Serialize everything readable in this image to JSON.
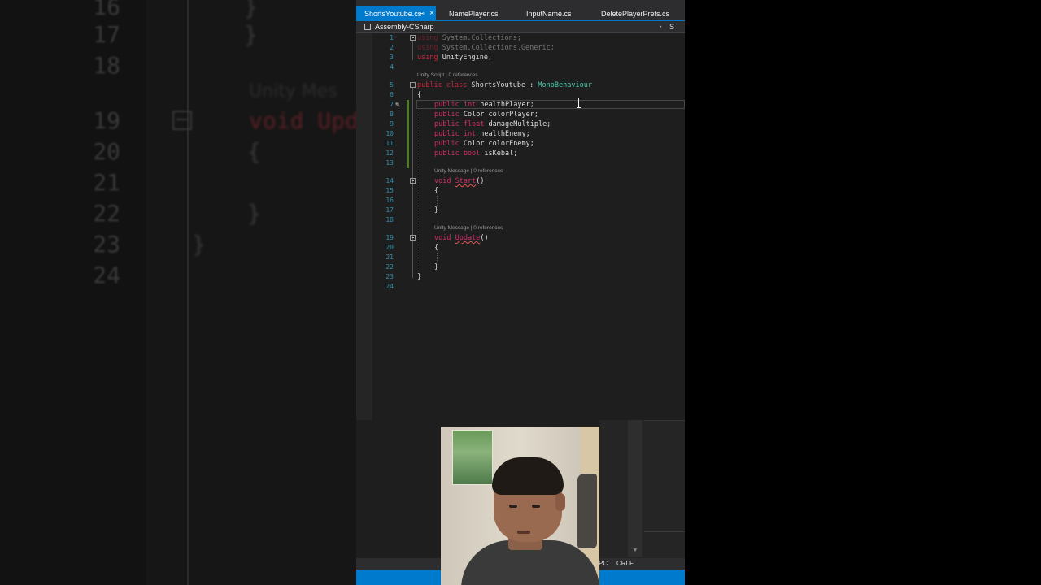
{
  "background_zoom": {
    "line_numbers": [
      "16",
      "17",
      "18",
      "19",
      "20",
      "21",
      "22",
      "23",
      "24"
    ],
    "codelens": "Unity Mes",
    "code_void": "void Upd",
    "brace_open": "{",
    "brace_close": "}"
  },
  "tabs": [
    {
      "label": "ShortsYoutube.cs",
      "active": true,
      "pin": "⊸",
      "close": "×"
    },
    {
      "label": "NamePlayer.cs"
    },
    {
      "label": "InputName.cs"
    },
    {
      "label": "DeletePlayerPrefs.cs"
    }
  ],
  "navbar": {
    "project": "Assembly-CSharp",
    "dropdown": "▾",
    "right_label": "S"
  },
  "editor": {
    "line_numbers": [
      "1",
      "2",
      "3",
      "4",
      "5",
      "6",
      "7",
      "8",
      "9",
      "10",
      "11",
      "12",
      "13",
      "14",
      "15",
      "16",
      "17",
      "18",
      "19",
      "20",
      "21",
      "22",
      "23",
      "24"
    ],
    "codelens": {
      "class": "Unity Script | 0 references",
      "start": "Unity Message | 0 references",
      "update": "Unity Message | 0 references"
    },
    "lines": {
      "l1_kw": "using",
      "l1_rest": " System.Collections;",
      "l2_kw": "using",
      "l2_rest": " System.Collections.Generic;",
      "l3_kw": "using",
      "l3_rest": " UnityEngine;",
      "l5_kw": "public class",
      "l5_name": " ShortsYoutube : ",
      "l5_base": "MonoBehaviour",
      "l6": "{",
      "l7_kw": "public int",
      "l7_rest": " healthPlayer;",
      "l8_kw": "public",
      "l8_rest": " Color colorPlayer;",
      "l9_kw": "public float",
      "l9_rest": " damageMultiple;",
      "l10_kw": "public int",
      "l10_rest": " healthEnemy;",
      "l11_kw": "public",
      "l11_rest": " Color colorEnemy;",
      "l12_kw": "public bool",
      "l12_rest": " isKebal;",
      "l14_kw": "void",
      "l14_name": "Start",
      "l14_rest": "()",
      "l15": "{",
      "l17": "}",
      "l19_kw": "void",
      "l19_name": "Update",
      "l19_rest": "()",
      "l20": "{",
      "l22": "}",
      "l23": "}"
    }
  },
  "status": {
    "pc": "PC",
    "crlf": "CRLF"
  }
}
